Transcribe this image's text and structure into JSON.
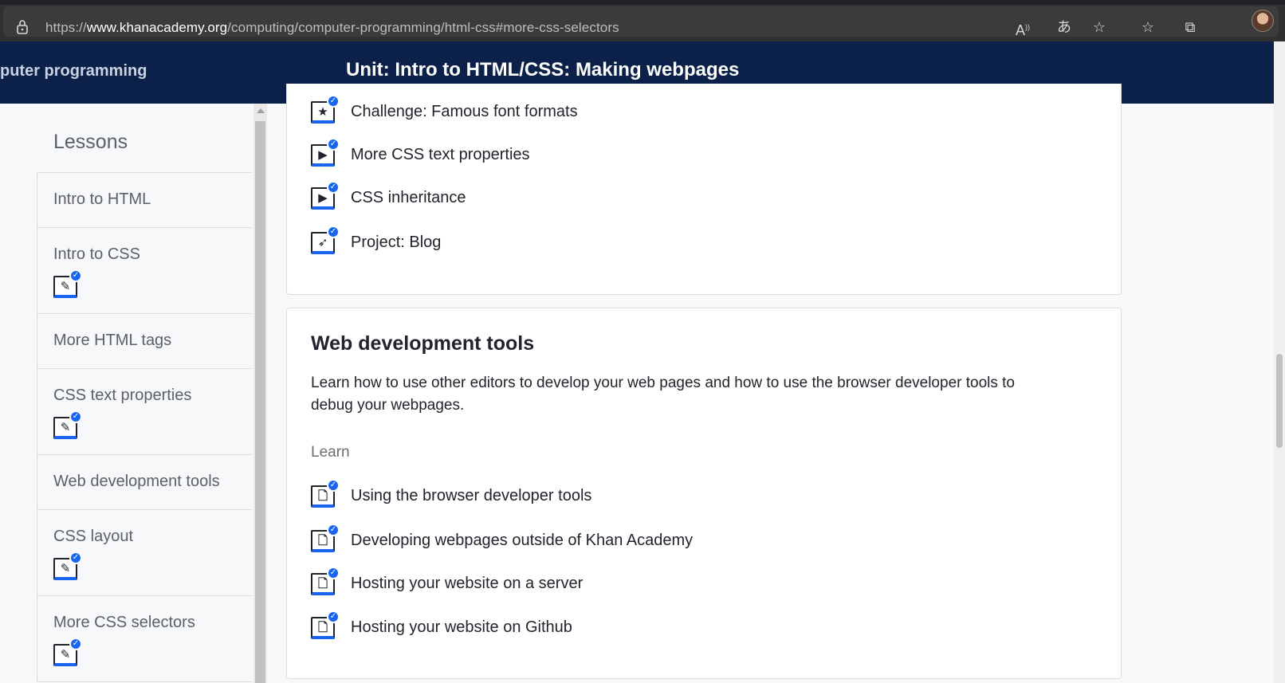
{
  "browser": {
    "url_prefix": "https://",
    "url_host": "www.khanacademy.org",
    "url_path": "/computing/computer-programming/html-css#more-css-selectors",
    "icons": [
      "read-aloud-icon",
      "translate-icon",
      "add-favorite-icon",
      "favorites-icon",
      "collections-icon",
      "profile-avatar"
    ]
  },
  "header": {
    "breadcrumb": "puter programming",
    "unit_title": "Unit: Intro to HTML/CSS: Making webpages"
  },
  "sidebar": {
    "title": "Lessons",
    "lessons": [
      {
        "label": "Intro to HTML",
        "icon": null
      },
      {
        "label": "Intro to CSS",
        "icon": "pencil-icon"
      },
      {
        "label": "More HTML tags",
        "icon": null
      },
      {
        "label": "CSS text properties",
        "icon": "pencil-icon"
      },
      {
        "label": "Web development tools",
        "icon": null
      },
      {
        "label": "CSS layout",
        "icon": "pencil-icon"
      },
      {
        "label": "More CSS selectors",
        "icon": "pencil-icon"
      }
    ]
  },
  "prev_section": {
    "items": [
      {
        "label": "Challenge: Famous font formats",
        "icon": "star-icon"
      },
      {
        "label": "More CSS text properties",
        "icon": "play-icon"
      },
      {
        "label": "CSS inheritance",
        "icon": "play-icon"
      },
      {
        "label": "Project: Blog",
        "icon": "rocket-icon"
      }
    ]
  },
  "web_dev_section": {
    "title": "Web development tools",
    "description": "Learn how to use other editors to develop your web pages and how to use the browser developer tools to debug your webpages.",
    "learn_label": "Learn",
    "items": [
      {
        "label": "Using the browser developer tools",
        "icon": "article-icon"
      },
      {
        "label": "Developing webpages outside of Khan Academy",
        "icon": "article-icon"
      },
      {
        "label": "Hosting your website on a server",
        "icon": "article-icon"
      },
      {
        "label": "Hosting your website on Github",
        "icon": "article-icon"
      }
    ]
  },
  "colors": {
    "header_bg": "#0b2149",
    "accent": "#1865f2",
    "text": "#21242c"
  }
}
